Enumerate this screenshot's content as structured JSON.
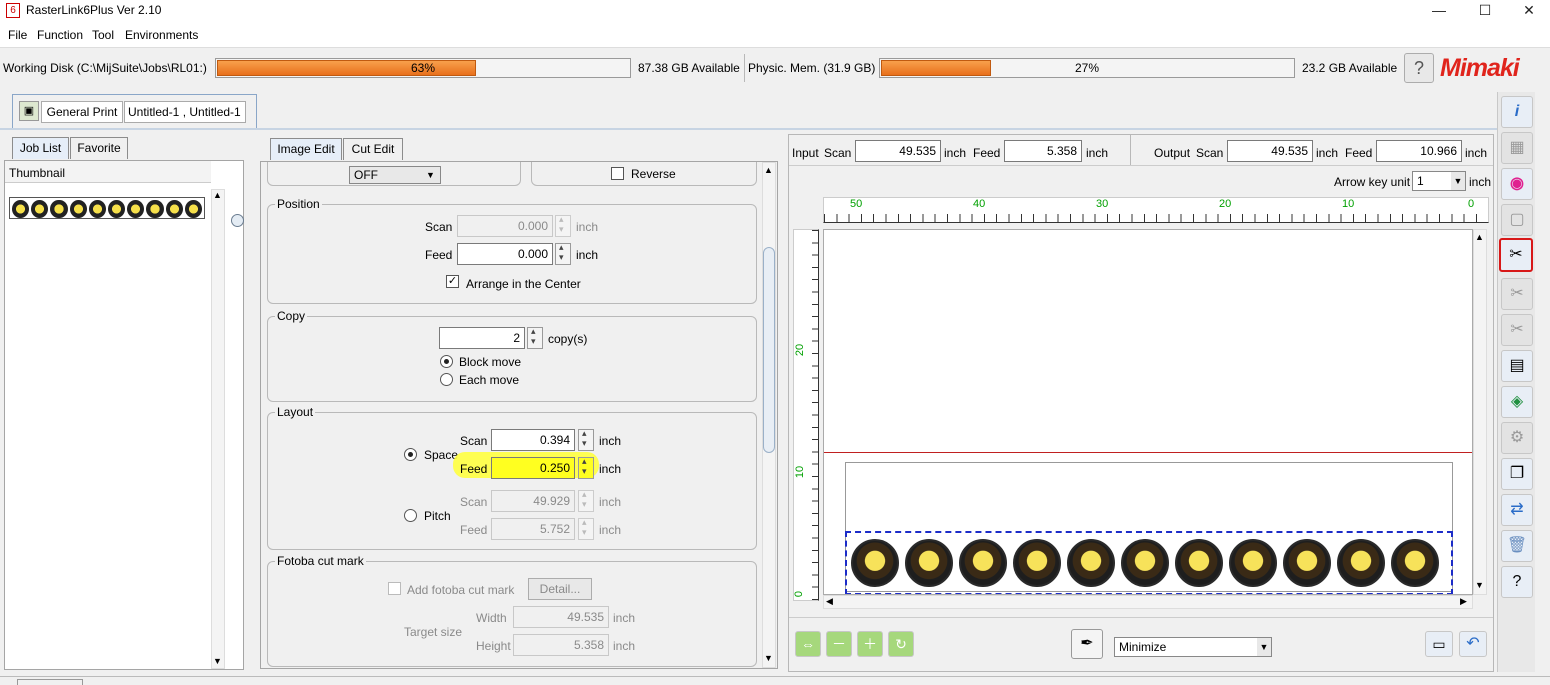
{
  "window": {
    "title": "RasterLink6Plus Ver 2.10"
  },
  "menu": [
    "File",
    "Function",
    "Tool",
    "Environments"
  ],
  "status": {
    "disk_label": "Working Disk (C:\\MijSuite\\Jobs\\RL01:)",
    "disk_progress": 63,
    "disk_progress_text": "63%",
    "disk_available": "87.38 GB Available",
    "mem_label": "Physic. Mem. (31.9 GB)",
    "mem_progress": 27,
    "mem_progress_text": "27%",
    "mem_available": "23.2 GB Available",
    "help": "?",
    "logo": "Mimaki"
  },
  "job_header": {
    "print_mode": "General Print",
    "job_name": "Untitled-1 , Untitled-1"
  },
  "left_tabs": [
    "Job List",
    "Favorite"
  ],
  "left_list": {
    "column": "Thumbnail"
  },
  "center_tabs": [
    "Image Edit",
    "Cut Edit"
  ],
  "top_row": {
    "select_value": "OFF",
    "reverse_label": "Reverse"
  },
  "position": {
    "title": "Position",
    "scan_label": "Scan",
    "scan_value": "0.000",
    "unit": "inch",
    "feed_label": "Feed",
    "feed_value": "0.000",
    "center_label": "Arrange in the Center"
  },
  "copy": {
    "title": "Copy",
    "count": "2",
    "unit": "copy(s)",
    "block_move": "Block move",
    "each_move": "Each move"
  },
  "layout": {
    "title": "Layout",
    "space_label": "Space",
    "pitch_label": "Pitch",
    "scan_label": "Scan",
    "feed_label": "Feed",
    "unit": "inch",
    "space_scan": "0.394",
    "space_feed": "0.250",
    "pitch_scan": "49.929",
    "pitch_feed": "5.752"
  },
  "fotoba": {
    "title": "Fotoba cut mark",
    "add_label": "Add fotoba cut mark",
    "detail": "Detail...",
    "target_label": "Target size",
    "width_label": "Width",
    "width": "49.535",
    "height_label": "Height",
    "height": "5.358",
    "unit": "inch"
  },
  "preview": {
    "input_label": "Input",
    "output_label": "Output",
    "scan_label": "Scan",
    "feed_label": "Feed",
    "unit": "inch",
    "input_scan": "49.535",
    "input_feed": "5.358",
    "output_scan": "49.535",
    "output_feed": "10.966",
    "arrow_label": "Arrow key unit",
    "arrow_value": "1",
    "ruler_top": [
      "50",
      "40",
      "30",
      "20",
      "10",
      "0"
    ],
    "ruler_left": [
      "20",
      "10",
      "0"
    ],
    "minimize": "Minimize"
  },
  "colors": {
    "accent": "#e8701c",
    "highlight": "#ffff00",
    "logo": "#e0241c",
    "ruler": "#00a000"
  }
}
